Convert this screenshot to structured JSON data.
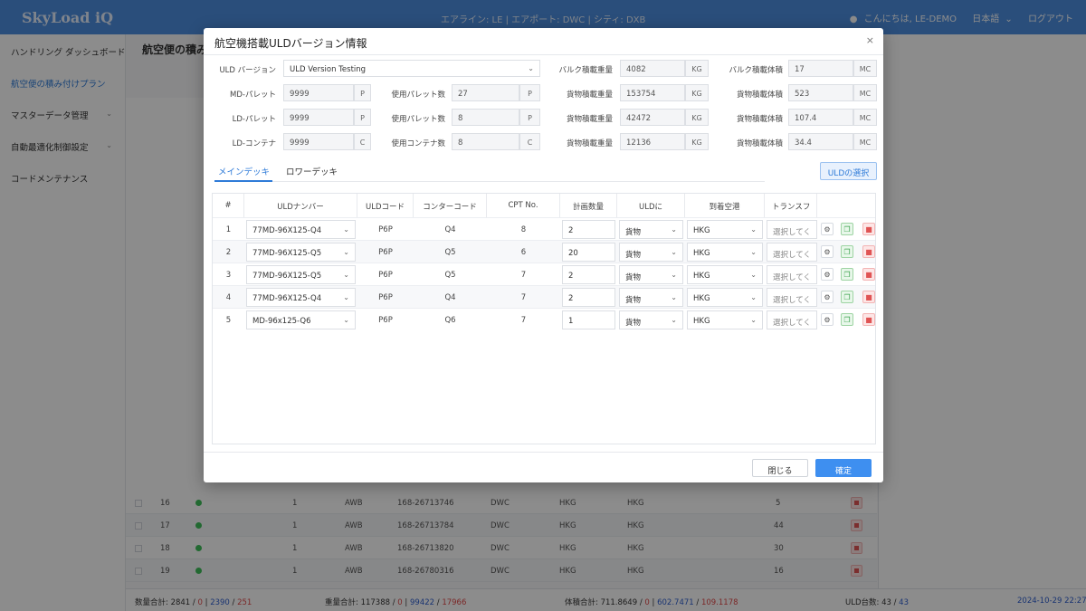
{
  "header": {
    "logo": "SkyLoad iQ",
    "info": "エアライン: LE | エアポート: DWC | シティ: DXB",
    "greeting": "こんにちは, LE-DEMO",
    "language": "日本語",
    "logout": "ログアウト"
  },
  "sidebar": {
    "items": [
      {
        "label": "ハンドリング ダッシュボード",
        "active": false
      },
      {
        "label": "航空便の積み付けプラン",
        "active": true
      },
      {
        "label": "マスターデータ管理",
        "active": false
      },
      {
        "label": "自動最適化制御設定",
        "active": false
      },
      {
        "label": "コードメンテナンス",
        "active": false
      }
    ]
  },
  "background": {
    "title": "航空便の積み",
    "rows": [
      {
        "no": "16",
        "pcs": "1",
        "type": "AWB",
        "awb": "168-26713746",
        "org": "DWC",
        "dest1": "HKG",
        "dest2": "HKG",
        "qty": "5"
      },
      {
        "no": "17",
        "pcs": "1",
        "type": "AWB",
        "awb": "168-26713784",
        "org": "DWC",
        "dest1": "HKG",
        "dest2": "HKG",
        "qty": "44"
      },
      {
        "no": "18",
        "pcs": "1",
        "type": "AWB",
        "awb": "168-26713820",
        "org": "DWC",
        "dest1": "HKG",
        "dest2": "HKG",
        "qty": "30"
      },
      {
        "no": "19",
        "pcs": "1",
        "type": "AWB",
        "awb": "168-26780316",
        "org": "DWC",
        "dest1": "HKG",
        "dest2": "HKG",
        "qty": "16"
      }
    ],
    "footer": {
      "qty_label": "数量合計: 2841",
      "qty_a": "0",
      "qty_b": "2390",
      "qty_c": "251",
      "wt_label": "重量合計: 117388",
      "wt_a": "0",
      "wt_b": "99422",
      "wt_c": "17966",
      "vol_label": "体積合計: 711.8649",
      "vol_a": "0",
      "vol_b": "602.7471",
      "vol_c": "109.1178",
      "uld_label": "ULD台数: 43",
      "uld_a": "43",
      "datetime": "2024-10-29 22:27"
    }
  },
  "modal": {
    "title": "航空機搭載ULDバージョン情報",
    "close_icon": "×",
    "uld_version_label": "ULD バージョン",
    "uld_version_value": "ULD Version Testing",
    "left_fields": [
      {
        "label": "MD-パレット",
        "value": "9999",
        "unit": "P",
        "used_label": "使用パレット数",
        "used_value": "27",
        "used_unit": "P"
      },
      {
        "label": "LD-パレット",
        "value": "9999",
        "unit": "P",
        "used_label": "使用パレット数",
        "used_value": "8",
        "used_unit": "P"
      },
      {
        "label": "LD-コンテナ",
        "value": "9999",
        "unit": "C",
        "used_label": "使用コンテナ数",
        "used_value": "8",
        "used_unit": "C"
      }
    ],
    "right_fields": [
      {
        "w_label": "バルク積載重量",
        "w_value": "4082",
        "w_unit": "KG",
        "v_label": "バルク積載体積",
        "v_value": "17",
        "v_unit": "MC"
      },
      {
        "w_label": "貨物積載重量",
        "w_value": "153754",
        "w_unit": "KG",
        "v_label": "貨物積載体積",
        "v_value": "523",
        "v_unit": "MC"
      },
      {
        "w_label": "貨物積載重量",
        "w_value": "42472",
        "w_unit": "KG",
        "v_label": "貨物積載体積",
        "v_value": "107.4",
        "v_unit": "MC"
      },
      {
        "w_label": "貨物積載重量",
        "w_value": "12136",
        "w_unit": "KG",
        "v_label": "貨物積載体積",
        "v_value": "34.4",
        "v_unit": "MC"
      }
    ],
    "tabs": [
      "メインデッキ",
      "ロワーデッキ"
    ],
    "uld_select_button": "ULDの選択",
    "columns": [
      "#",
      "ULDナンバー",
      "ULDコード",
      "コンターコード",
      "CPT No.",
      "計画数量",
      "ULDに",
      "到着空港",
      "トランスフ"
    ],
    "rows": [
      {
        "no": "1",
        "uld": "77MD-96X125-Q4",
        "code": "P6P",
        "contour": "Q4",
        "cpt": "8",
        "qty": "2",
        "kind": "貨物",
        "dest": "HKG",
        "transfer": "選択してく"
      },
      {
        "no": "2",
        "uld": "77MD-96X125-Q5",
        "code": "P6P",
        "contour": "Q5",
        "cpt": "6",
        "qty": "20",
        "kind": "貨物",
        "dest": "HKG",
        "transfer": "選択してく"
      },
      {
        "no": "3",
        "uld": "77MD-96X125-Q5",
        "code": "P6P",
        "contour": "Q5",
        "cpt": "7",
        "qty": "2",
        "kind": "貨物",
        "dest": "HKG",
        "transfer": "選択してく"
      },
      {
        "no": "4",
        "uld": "77MD-96X125-Q4",
        "code": "P6P",
        "contour": "Q4",
        "cpt": "7",
        "qty": "2",
        "kind": "貨物",
        "dest": "HKG",
        "transfer": "選択してく"
      },
      {
        "no": "5",
        "uld": "MD-96x125-Q6",
        "code": "P6P",
        "contour": "Q6",
        "cpt": "7",
        "qty": "1",
        "kind": "貨物",
        "dest": "HKG",
        "transfer": "選択してく"
      }
    ],
    "close_button": "閉じる",
    "confirm_button": "確定"
  }
}
